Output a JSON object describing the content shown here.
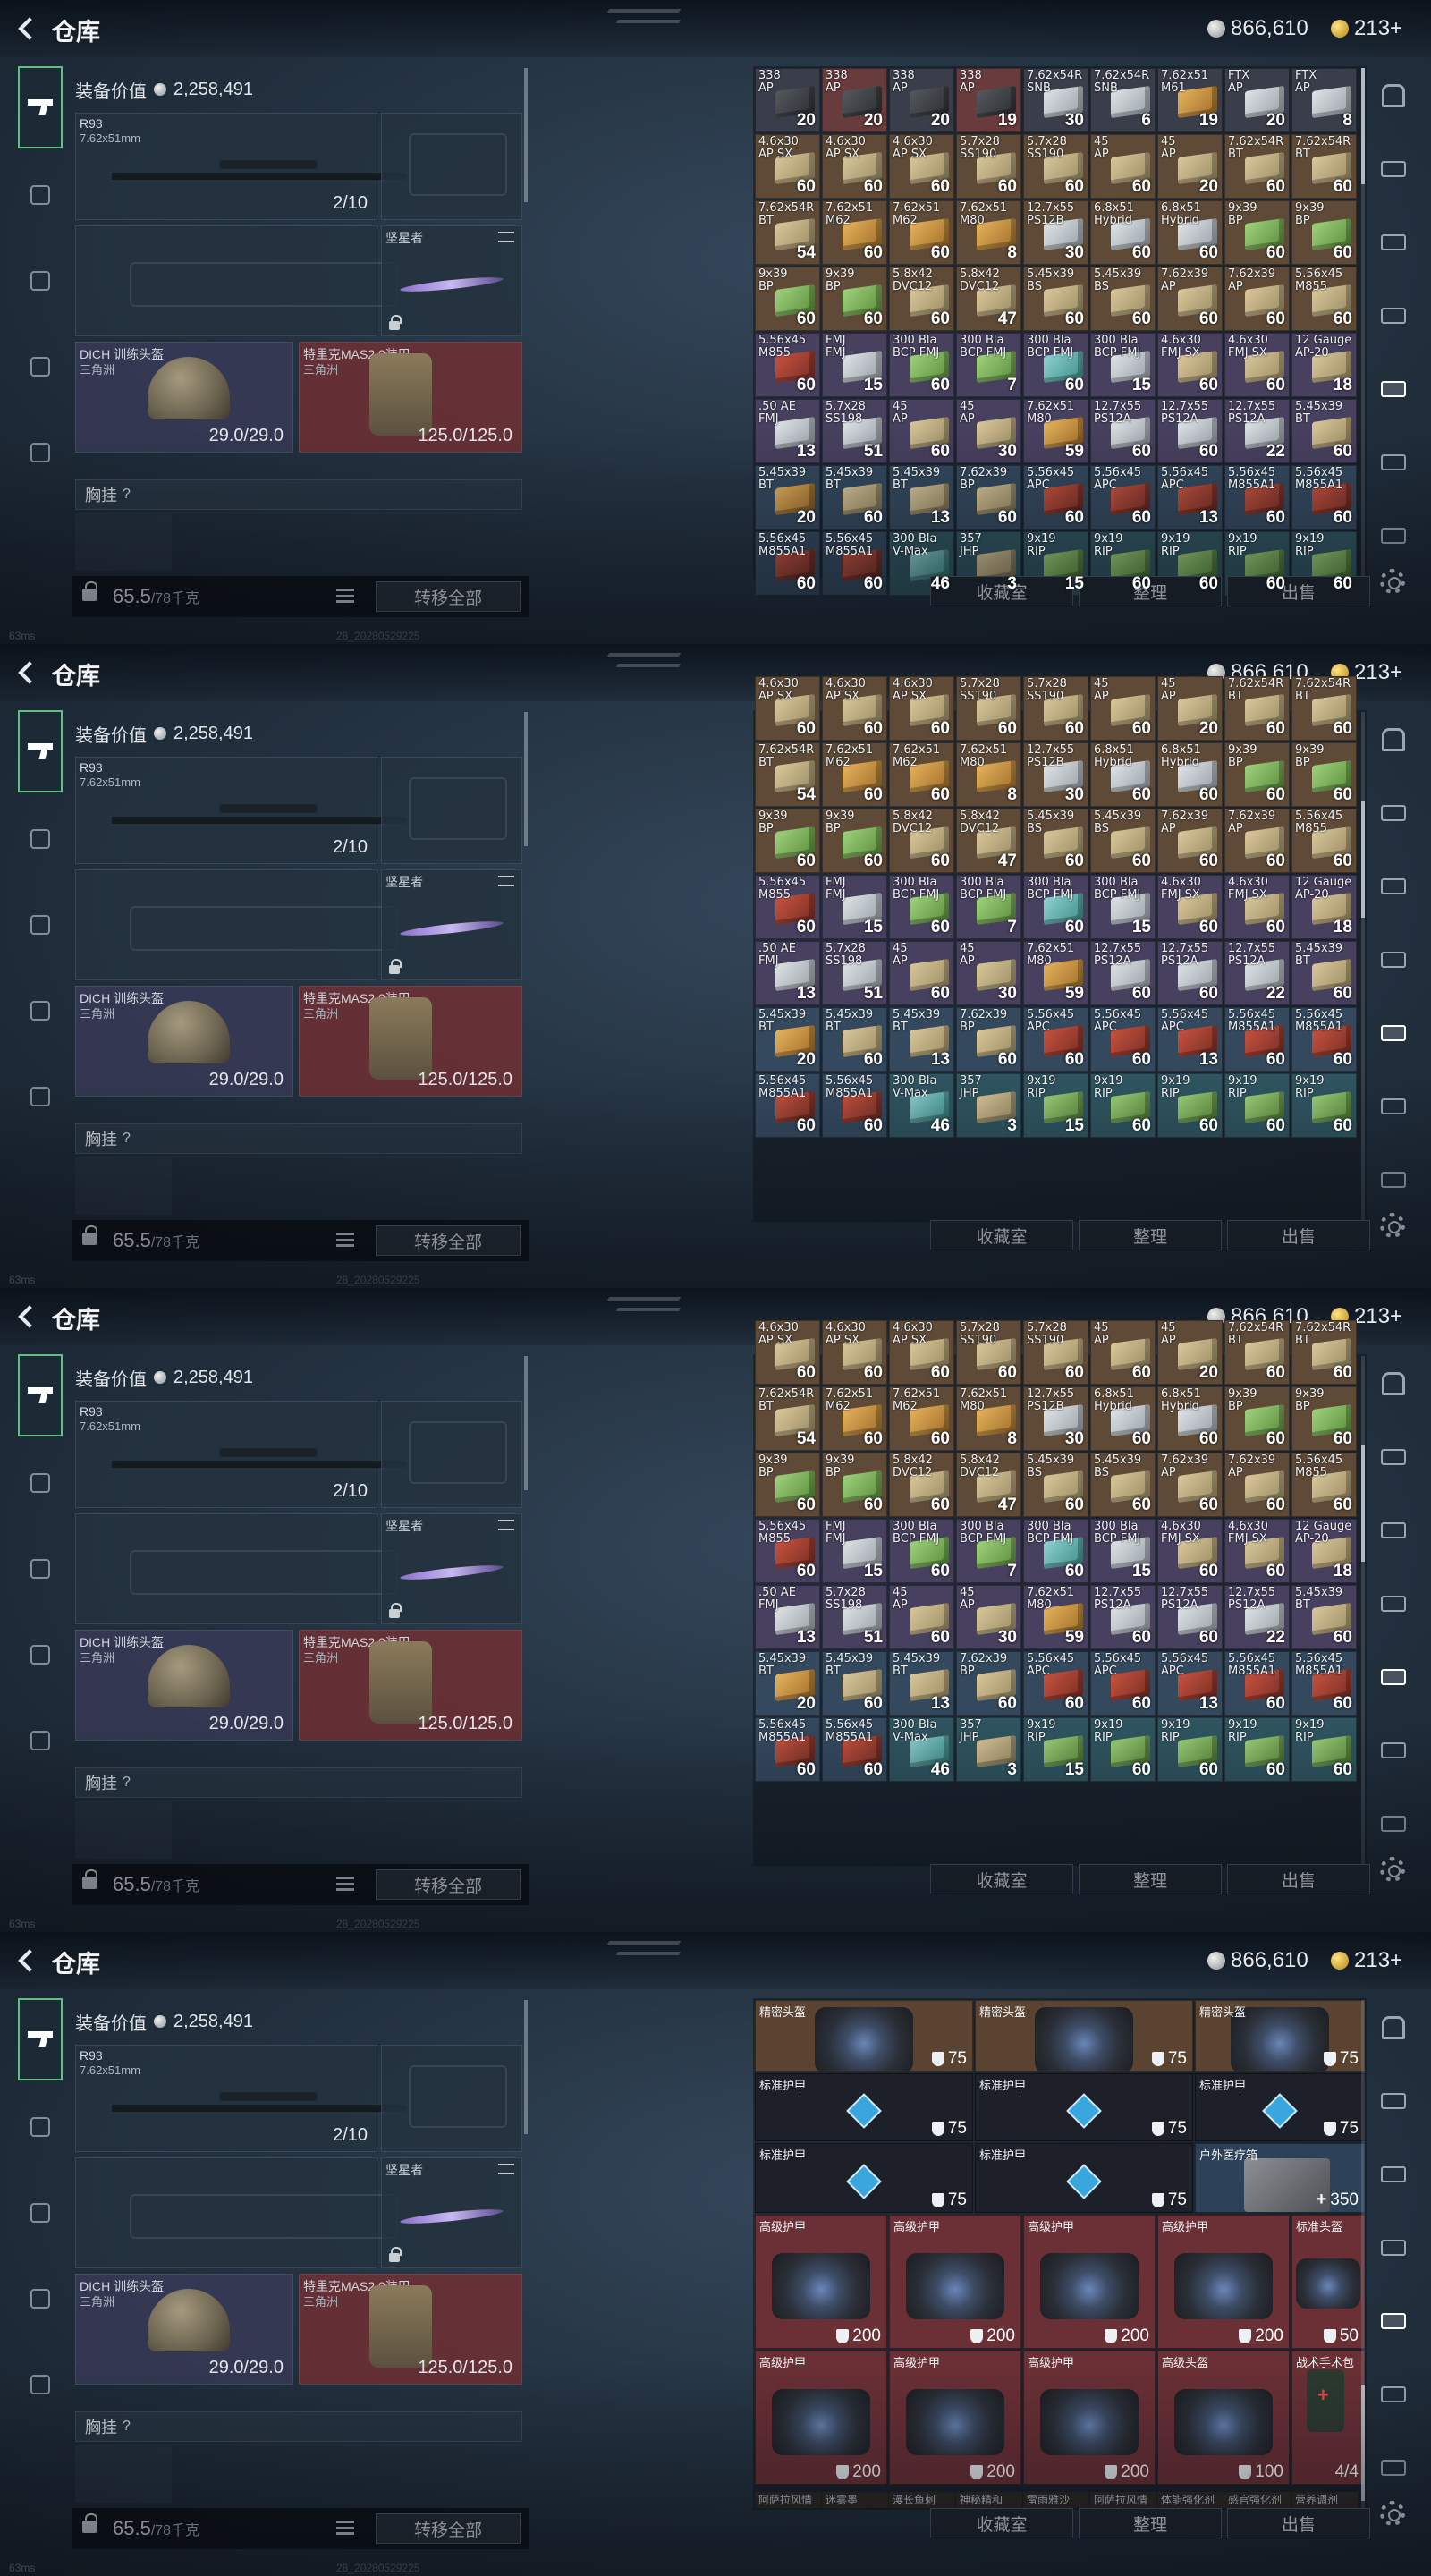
{
  "window": {
    "title": "仓库",
    "silver": "866,610",
    "gold": "213+"
  },
  "equipment": {
    "value_label": "装备价值",
    "value": "2,258,491",
    "primary_name": "R93",
    "primary_caliber": "7.62x51mm",
    "primary_ammo": "2/10",
    "melee_name": "坚星者",
    "helmet_name": "DICH 训练头盔",
    "helmet_map": "三角洲",
    "helmet_durability": "29.0/29.0",
    "armor_name": "特里克MAS2.0装甲",
    "armor_map": "三角洲",
    "armor_durability": "125.0/125.0",
    "chest_label": "胸挂",
    "chest_help": "?",
    "weight": "65.5",
    "weight_unit": "/78千克",
    "transfer_all": "转移全部"
  },
  "stash": {
    "actions": [
      "收藏室",
      "整理",
      "出售"
    ],
    "frames": [
      {
        "rows": [
          [
            [
              "338",
              "AP",
              "20",
              "dark",
              "dark"
            ],
            [
              "338",
              "AP",
              "20",
              "red",
              "dark"
            ],
            [
              "338",
              "AP",
              "20",
              "dark",
              "dark"
            ],
            [
              "338",
              "AP",
              "19",
              "red",
              "dark"
            ],
            [
              "7.62x54R",
              "SNB",
              "30",
              "dark",
              "white"
            ],
            [
              "7.62x54R",
              "SNB",
              "6",
              "dark",
              "white"
            ],
            [
              "7.62x51",
              "M61",
              "19",
              "dark",
              "gold"
            ],
            [
              "FTX",
              "AP",
              "20",
              "dark",
              "white"
            ],
            [
              "FTX",
              "AP",
              "8",
              "dark",
              "white"
            ]
          ],
          [
            [
              "4.6x30",
              "AP SX",
              "60",
              "brown",
              "tan"
            ],
            [
              "4.6x30",
              "AP SX",
              "60",
              "brown",
              "tan"
            ],
            [
              "4.6x30",
              "AP SX",
              "60",
              "brown",
              "tan"
            ],
            [
              "5.7x28",
              "SS190",
              "60",
              "brown",
              "tan"
            ],
            [
              "5.7x28",
              "SS190",
              "60",
              "brown",
              "tan"
            ],
            [
              "45",
              "AP",
              "60",
              "brown",
              "tan"
            ],
            [
              "45",
              "AP",
              "20",
              "brown",
              "tan"
            ],
            [
              "7.62x54R",
              "BT",
              "60",
              "brown",
              "tan"
            ],
            [
              "7.62x54R",
              "BT",
              "60",
              "brown",
              "tan"
            ]
          ],
          [
            [
              "7.62x54R",
              "BT",
              "54",
              "brown",
              "tan"
            ],
            [
              "7.62x51",
              "M62",
              "60",
              "brown",
              "gold"
            ],
            [
              "7.62x51",
              "M62",
              "60",
              "brown",
              "gold"
            ],
            [
              "7.62x51",
              "M80",
              "8",
              "brown",
              "gold"
            ],
            [
              "12.7x55",
              "PS12B",
              "30",
              "brown",
              "white"
            ],
            [
              "6.8x51",
              "Hybrid",
              "60",
              "brown",
              "white"
            ],
            [
              "6.8x51",
              "Hybrid",
              "60",
              "brown",
              "white"
            ],
            [
              "9x39",
              "BP",
              "60",
              "brown",
              "green"
            ],
            [
              "9x39",
              "BP",
              "60",
              "brown",
              "green"
            ]
          ],
          [
            [
              "9x39",
              "BP",
              "60",
              "brown",
              "green"
            ],
            [
              "9x39",
              "BP",
              "60",
              "brown",
              "green"
            ],
            [
              "5.8x42",
              "DVC12",
              "60",
              "brown",
              "tan"
            ],
            [
              "5.8x42",
              "DVC12",
              "47",
              "brown",
              "tan"
            ],
            [
              "5.45x39",
              "BS",
              "60",
              "brown",
              "tan"
            ],
            [
              "5.45x39",
              "BS",
              "60",
              "brown",
              "tan"
            ],
            [
              "7.62x39",
              "AP",
              "60",
              "brown",
              "tan"
            ],
            [
              "7.62x39",
              "AP",
              "60",
              "brown",
              "tan"
            ],
            [
              "5.56x45",
              "M855",
              "60",
              "brown",
              "tan"
            ]
          ],
          [
            [
              "5.56x45",
              "M855",
              "60",
              "purple",
              "red"
            ],
            [
              "FMJ",
              "FMJ",
              "15",
              "purple",
              "white"
            ],
            [
              "300 Bla",
              "BCP FMJ",
              "60",
              "purple",
              "green"
            ],
            [
              "300 Bla",
              "BCP FMJ",
              "7",
              "purple",
              "green"
            ],
            [
              "300 Bla",
              "BCP FMJ",
              "60",
              "purple",
              "teal"
            ],
            [
              "300 Bla",
              "BCP FMJ",
              "15",
              "purple",
              "white"
            ],
            [
              "4.6x30",
              "FMJ SX",
              "60",
              "purple",
              "tan"
            ],
            [
              "4.6x30",
              "FMJ SX",
              "60",
              "purple",
              "tan"
            ],
            [
              "12 Gauge",
              "AP-20",
              "18",
              "purple",
              "tan"
            ]
          ],
          [
            [
              ".50 AE",
              "FMJ",
              "13",
              "purple",
              "white"
            ],
            [
              "5.7x28",
              "SS198",
              "51",
              "purple",
              "white"
            ],
            [
              "45",
              "AP",
              "60",
              "purple",
              "tan"
            ],
            [
              "45",
              "AP",
              "30",
              "purple",
              "tan"
            ],
            [
              "7.62x51",
              "M80",
              "59",
              "purple",
              "gold"
            ],
            [
              "12.7x55",
              "PS12A",
              "60",
              "purple",
              "white"
            ],
            [
              "12.7x55",
              "PS12A",
              "60",
              "purple",
              "white"
            ],
            [
              "12.7x55",
              "PS12A",
              "22",
              "purple",
              "white"
            ],
            [
              "5.45x39",
              "BT",
              "60",
              "purple",
              "tan"
            ]
          ],
          [
            [
              "5.45x39",
              "BT",
              "20",
              "blue",
              "gold"
            ],
            [
              "5.45x39",
              "BT",
              "60",
              "blue",
              "tan"
            ],
            [
              "5.45x39",
              "BT",
              "13",
              "blue",
              "tan"
            ],
            [
              "7.62x39",
              "BP",
              "60",
              "blue",
              "tan"
            ],
            [
              "5.56x45",
              "APC",
              "60",
              "blue",
              "red"
            ],
            [
              "5.56x45",
              "APC",
              "60",
              "blue",
              "red"
            ],
            [
              "5.56x45",
              "APC",
              "13",
              "blue",
              "red"
            ],
            [
              "5.56x45",
              "M855A1",
              "60",
              "blue",
              "red"
            ],
            [
              "5.56x45",
              "M855A1",
              "60",
              "blue",
              "red"
            ]
          ],
          [
            [
              "5.56x45",
              "M855A1",
              "60",
              "blue",
              "red"
            ],
            [
              "5.56x45",
              "M855A1",
              "60",
              "blue",
              "red"
            ],
            [
              "300 Bla",
              "V-Max",
              "46",
              "teal",
              "teal"
            ],
            [
              "357",
              "JHP",
              "3",
              "teal",
              "tan"
            ],
            [
              "9x19",
              "RIP",
              "15",
              "teal",
              "green"
            ],
            [
              "9x19",
              "RIP",
              "60",
              "teal",
              "green"
            ],
            [
              "9x19",
              "RIP",
              "60",
              "teal",
              "green"
            ],
            [
              "9x19",
              "RIP",
              "60",
              "teal",
              "green"
            ],
            [
              "9x19",
              "RIP",
              "60",
              "teal",
              "green"
            ]
          ]
        ]
      }
    ],
    "gear": {
      "items": [
        {
          "name": "精密头盔",
          "value": "75",
          "color": "brown",
          "icon": "shield"
        },
        {
          "name": "精密头盔",
          "value": "75",
          "color": "brown",
          "icon": "shield"
        },
        {
          "name": "精密头盔",
          "value": "75",
          "color": "brown",
          "icon": "shield"
        },
        {
          "name": "标准护甲",
          "value": "75",
          "color": "dark",
          "icon": "shield"
        },
        {
          "name": "标准护甲",
          "value": "75",
          "color": "dark",
          "icon": "shield"
        },
        {
          "name": "标准护甲",
          "value": "75",
          "color": "dark",
          "icon": "shield"
        },
        {
          "name": "标准护甲",
          "value": "75",
          "color": "dark",
          "icon": "shield"
        },
        {
          "name": "标准护甲",
          "value": "75",
          "color": "dark",
          "icon": "shield"
        },
        {
          "name": "户外医疗箱",
          "value": "350",
          "color": "blue",
          "icon": "plus"
        },
        {
          "name": "高级护甲",
          "value": "200",
          "color": "red",
          "icon": "shield"
        },
        {
          "name": "高级护甲",
          "value": "200",
          "color": "red",
          "icon": "shield"
        },
        {
          "name": "高级护甲",
          "value": "200",
          "color": "red",
          "icon": "shield"
        },
        {
          "name": "高级护甲",
          "value": "200",
          "color": "red",
          "icon": "shield"
        },
        {
          "name": "标准头盔",
          "value": "50",
          "color": "red",
          "icon": "shield"
        },
        {
          "name": "高级护甲",
          "value": "200",
          "color": "red",
          "icon": "shield"
        },
        {
          "name": "高级护甲",
          "value": "200",
          "color": "red",
          "icon": "shield"
        },
        {
          "name": "高级护甲",
          "value": "200",
          "color": "red",
          "icon": "shield"
        },
        {
          "name": "高级头盔",
          "value": "100",
          "color": "red",
          "icon": "shield"
        },
        {
          "name": "战术手术包",
          "value": "4/4",
          "color": "red",
          "icon": "none"
        }
      ],
      "strip": [
        "阿萨拉风情",
        "迷雾墨",
        "漫长鱼刺",
        "神秘精和",
        "雷雨雅沙",
        "阿萨拉风情",
        "体能强化剂",
        "感官强化剂",
        "营养调剂"
      ]
    }
  },
  "status": {
    "ping": "63ms",
    "build": "28_20280529225"
  },
  "icons": [
    "back-arrow-icon",
    "silver-coin-icon",
    "gold-coin-icon",
    "gun-icon",
    "lock-icon",
    "swap-icon",
    "list-icon",
    "settings-icon",
    "shield-icon",
    "plus-icon"
  ]
}
